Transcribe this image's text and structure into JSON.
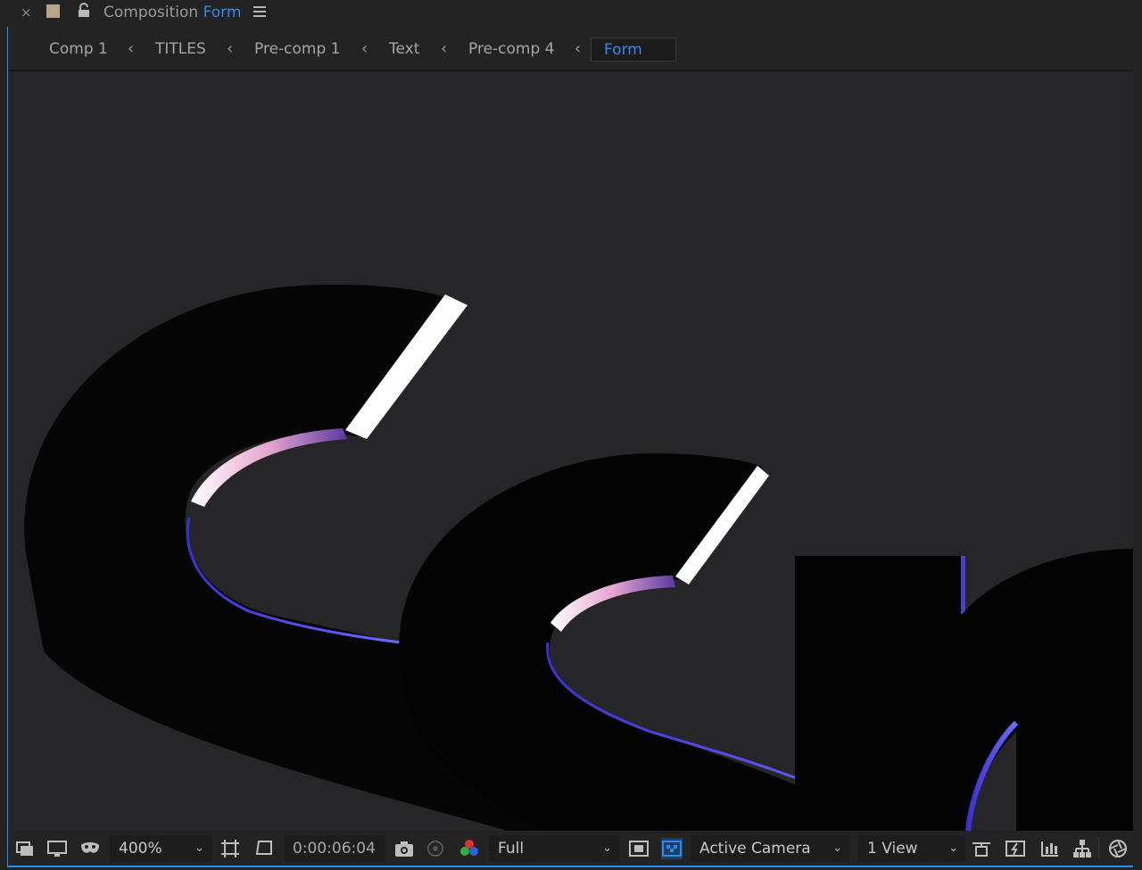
{
  "tab": {
    "close_glyph": "×",
    "swatch_color": "#b9a58a",
    "prefix": "Composition",
    "active_name": "Form",
    "icons": [
      "close-icon",
      "color-swatch-icon",
      "lock-icon",
      "menu-icon"
    ]
  },
  "breadcrumbs": [
    {
      "label": "Comp 1"
    },
    {
      "label": "TITLES"
    },
    {
      "label": "Pre-comp 1"
    },
    {
      "label": "Text"
    },
    {
      "label": "Pre-comp 4"
    },
    {
      "label": "Form",
      "active": true
    }
  ],
  "separator_glyph": "‹",
  "toolbar": {
    "zoom": "400%",
    "timecode": "0:00:06:04",
    "resolution": "Full",
    "camera": "Active Camera",
    "views": "1 View",
    "icons": [
      "always-preview-icon",
      "monitor-icon",
      "mask-visibility-icon",
      "grid-guides-icon",
      "region-of-interest-icon",
      "snapshot-icon",
      "show-snapshot-icon",
      "color-channels-icon",
      "fast-preview-icon",
      "transparency-grid-icon",
      "reset-exposure-icon",
      "motion-blur-icon",
      "graph-icon",
      "flowchart-icon",
      "exposure-icon"
    ]
  },
  "colors": {
    "accent": "#2d8ceb",
    "background": "#232323",
    "viewer_bg": "#262527"
  }
}
